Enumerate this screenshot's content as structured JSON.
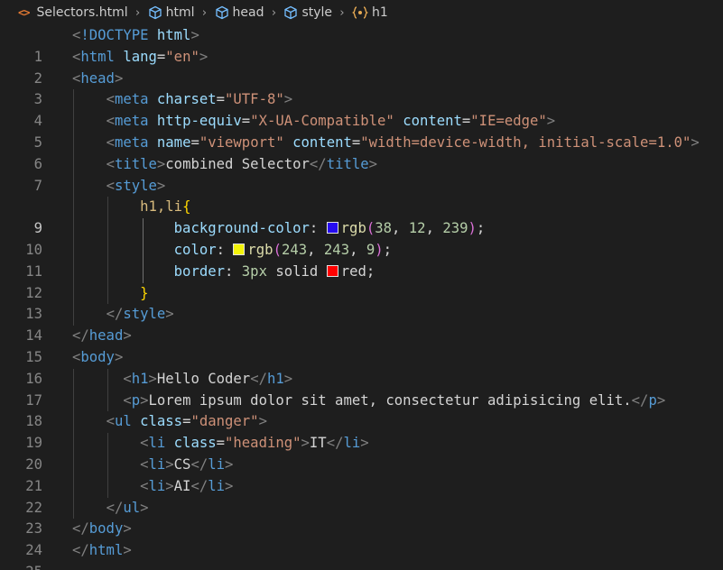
{
  "breadcrumb": {
    "file": "Selectors.html",
    "items": [
      "html",
      "head",
      "style",
      "h1"
    ]
  },
  "colors": {
    "background": "#1e1e1e",
    "tag": "#569cd6",
    "attribute": "#9cdcfe",
    "string": "#ce9178",
    "selector": "#d7ba7d",
    "number": "#b5cea8",
    "function": "#dcdcaa",
    "swatch_bg": "#260cef",
    "swatch_fg": "#f3f309",
    "swatch_border": "#ff0000"
  },
  "editor": {
    "active_line": 9,
    "lines": [
      {
        "n": "1"
      },
      {
        "n": "2"
      },
      {
        "n": "3"
      },
      {
        "n": "4"
      },
      {
        "n": "5"
      },
      {
        "n": "6"
      },
      {
        "n": "7"
      },
      {
        "n": "8"
      },
      {
        "n": "9"
      },
      {
        "n": "10"
      },
      {
        "n": "11"
      },
      {
        "n": "12"
      },
      {
        "n": "13"
      },
      {
        "n": "14"
      },
      {
        "n": "15"
      },
      {
        "n": "16"
      },
      {
        "n": "17"
      },
      {
        "n": "18"
      },
      {
        "n": "19"
      },
      {
        "n": "20"
      },
      {
        "n": "21"
      },
      {
        "n": "22"
      },
      {
        "n": "23"
      },
      {
        "n": "24"
      },
      {
        "n": "25"
      }
    ]
  },
  "code": {
    "doctype": "!DOCTYPE",
    "html": "html",
    "lang_attr": "lang",
    "lang_val": "\"en\"",
    "head": "head",
    "meta": "meta",
    "charset_attr": "charset",
    "charset_val": "\"UTF-8\"",
    "httpequiv_attr": "http-equiv",
    "httpequiv_val": "\"X-UA-Compatible\"",
    "content_attr": "content",
    "content_val1": "\"IE=edge\"",
    "name_attr": "name",
    "name_val": "\"viewport\"",
    "content_val2": "\"width=device-width, initial-scale=1.0\"",
    "title": "title",
    "title_text": "combined Selector",
    "style": "style",
    "selector": "h1,li",
    "prop_bg": "background-color",
    "rgb": "rgb",
    "bg_r": "38",
    "bg_g": "12",
    "bg_b": "239",
    "prop_color": "color",
    "fg_r": "243",
    "fg_g": "243",
    "fg_b": "9",
    "prop_border": "border",
    "border_width": "3px",
    "border_style": "solid",
    "border_color": "red",
    "body": "body",
    "h1": "h1",
    "h1_text": "Hello Coder",
    "p": "p",
    "p_text": "Lorem ipsum dolor sit amet, consectetur adipisicing elit.",
    "ul": "ul",
    "class_attr": "class",
    "danger_val": "\"danger\"",
    "li": "li",
    "heading_val": "\"heading\"",
    "li1_text": "IT",
    "li2_text": "CS",
    "li3_text": "AI"
  }
}
